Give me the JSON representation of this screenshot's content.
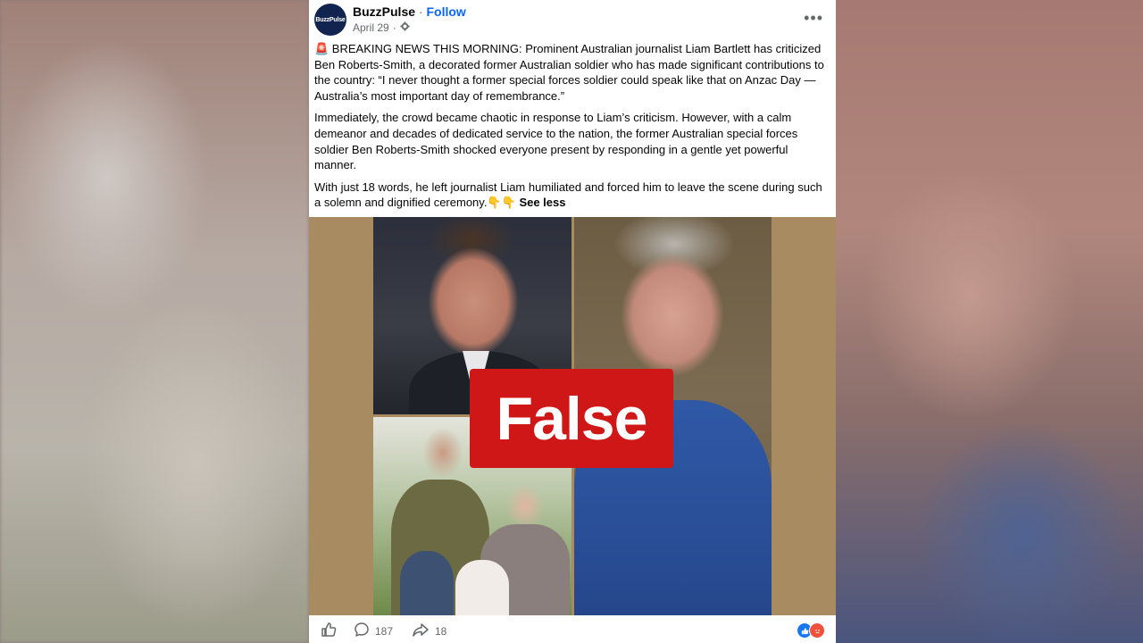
{
  "post": {
    "page_name": "BuzzPulse",
    "separator": "·",
    "follow_label": "Follow",
    "avatar_text": "BuzzPulse",
    "date": "April 29",
    "audience_icon": "gear-icon",
    "more_icon": "•••",
    "paragraphs": [
      "🚨 BREAKING NEWS THIS MORNING: Prominent Australian journalist Liam Bartlett has criticized Ben Roberts-Smith, a decorated former Australian soldier who has made significant contributions to the country: “I never thought a former special forces soldier could speak like that on Anzac Day — Australia’s most important day of remembrance.”",
      "Immediately, the crowd became chaotic in response to Liam’s criticism. However, with a calm demeanor and decades of dedicated service to the nation, the former Australian special forces soldier Ben Roberts-Smith shocked everyone present by responding in a gentle yet powerful manner.",
      "With just 18 words, he left journalist Liam humiliated and forced him to leave the scene during such a solemn and dignified ceremony.👇👇"
    ],
    "see_less": "See less",
    "image_overlay": "False",
    "comments_count": "187",
    "shares_count": "18"
  },
  "colors": {
    "follow": "#0866ff",
    "false_badge": "#cf1717",
    "photo_bg": "#a98b62"
  }
}
